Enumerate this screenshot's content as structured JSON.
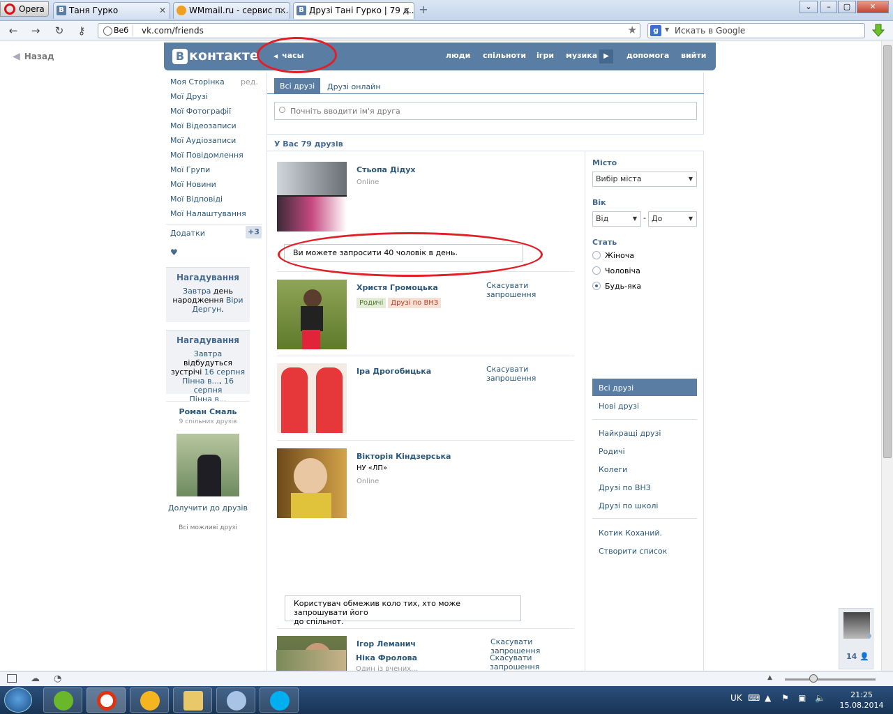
{
  "browser": {
    "opera_label": "Opera",
    "tabs": [
      {
        "label": "Таня Гурко",
        "icon": "В"
      },
      {
        "label": "WMmail.ru - сервис п...",
        "icon": "W"
      },
      {
        "label": "Друзі Тані Гурко | 79 д...",
        "icon": "В"
      }
    ],
    "web_badge": "Веб",
    "url": "vk.com/friends",
    "search_placeholder": "Искать в Google"
  },
  "page": {
    "back_label": "Назад",
    "logo_text": "контакте",
    "audio_label": "часы",
    "top_nav": [
      "люди",
      "спільноти",
      "ігри",
      "музика",
      "допомога",
      "вийти"
    ]
  },
  "left_menu": {
    "items": [
      "Моя Сторінка",
      "Мої Друзі",
      "Мої Фотографії",
      "Мої Відеозаписи",
      "Мої Аудіозаписи",
      "Мої Повідомлення",
      "Мої Групи",
      "Мої Новини",
      "Мої Відповіді",
      "Мої Налаштування"
    ],
    "edit_label": "ред.",
    "apps_label": "Додатки",
    "apps_count": "+3",
    "heart": "♥",
    "reminder1": {
      "title": "Нагадування",
      "l1a": "Завтра",
      "l1b": " день",
      "l2a": "народження ",
      "l2b": "Віри",
      "l3a": "Дергун",
      "l3b": "."
    },
    "reminder2": {
      "title": "Нагадування",
      "l1a": "Завтра",
      "l1b": " відбудуться",
      "l2a": "зустрічі ",
      "l2b": "16 серпня",
      "l3a": "Пінна в...",
      "l3b": ", ",
      "l3c": "16 серпня",
      "l4": "Пінна в..."
    },
    "suggestion": {
      "name": "Роман Смаль",
      "mutual": "9 спільних друзів",
      "add": "Долучити до друзів",
      "all": "Всі можливі друзі"
    }
  },
  "main": {
    "tab_all": "Всі друзі",
    "tab_online": "Друзі онлайн",
    "search_placeholder": "Почніть вводити ім'я друга",
    "count_text": "У Вас 79 друзів",
    "friends": [
      {
        "name": "Стьопа Дідух",
        "status": "Online"
      },
      {
        "name": "Христя Громоцька",
        "cancel": "Скасувати запрошення",
        "tags": [
          "Родичі",
          "Друзі по ВНЗ"
        ]
      },
      {
        "name": "Іра Дрогобицька",
        "cancel": "Скасувати запрошення"
      },
      {
        "name": "Вікторія Кіндзерська",
        "info": "НУ «ЛП»",
        "status": "Online"
      },
      {
        "name": "Ігор Леманич",
        "cancel_l1": "Скасувати",
        "cancel_l2": "запрошення"
      },
      {
        "name": "Ніка Фролова",
        "cancel_l1": "Скасувати",
        "cancel_l2": "запрошення",
        "sub": "Один із вчених..."
      }
    ],
    "notice1": "Ви можете запросити 40 чоловік в день.",
    "notice2_l1": "Користувач обмежив коло тих, хто може запрошувати його",
    "notice2_l2": "до спільнот."
  },
  "filters": {
    "city_label": "Місто",
    "city_select": "Вибір міста",
    "age_label": "Вік",
    "age_from": "Від",
    "age_dash": "-",
    "age_to": "До",
    "sex_label": "Стать",
    "sex_options": [
      "Жіноча",
      "Чоловіча",
      "Будь-яка"
    ],
    "lists": [
      "Всі друзі",
      "Нові друзі",
      "Найкращі друзі",
      "Родичі",
      "Колеги",
      "Друзі по ВНЗ",
      "Друзі по школі",
      "Котик Коханий.",
      "Створити список"
    ]
  },
  "side_widget": {
    "count": "14"
  },
  "taskbar": {
    "lang": "UK",
    "time": "21:25",
    "date": "15.08.2014"
  },
  "colors": {
    "vk_blue": "#597da3",
    "link": "#2b587a",
    "annotation_red": "#e21f26"
  }
}
